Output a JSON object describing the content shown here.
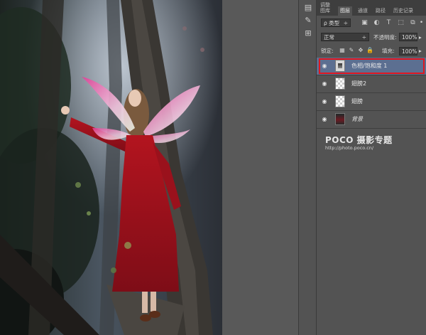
{
  "panel": {
    "tabs": [
      {
        "label": "调整",
        "sub": "图库"
      },
      {
        "label": "图层",
        "active": true
      },
      {
        "label": "通道"
      },
      {
        "label": "路径"
      },
      {
        "label": "历史记录"
      }
    ],
    "filter_kind": "ρ 类型",
    "filter_icons": [
      "image-filter-icon",
      "adjustment-filter-icon",
      "type-filter-icon",
      "shape-filter-icon",
      "smart-object-filter-icon"
    ],
    "blend_mode": "正常",
    "opacity_label": "不透明度:",
    "opacity_value": "100%",
    "lock_label": "锁定:",
    "fill_label": "填充:",
    "fill_value": "100%"
  },
  "layers": [
    {
      "name": "色相/饱和度 1",
      "type": "adjustment",
      "selected": true
    },
    {
      "name": "翅膀2",
      "type": "transparent"
    },
    {
      "name": "翅膀",
      "type": "transparent"
    },
    {
      "name": "背景",
      "type": "photo",
      "italic": true
    }
  ],
  "watermark": {
    "logo": "POCO 摄影专题",
    "url": "http://photo.poco.cn/"
  },
  "colors": {
    "selection_highlight": "#e0161f",
    "selected_layer": "#5c6f91",
    "dress": "#a5121f"
  }
}
